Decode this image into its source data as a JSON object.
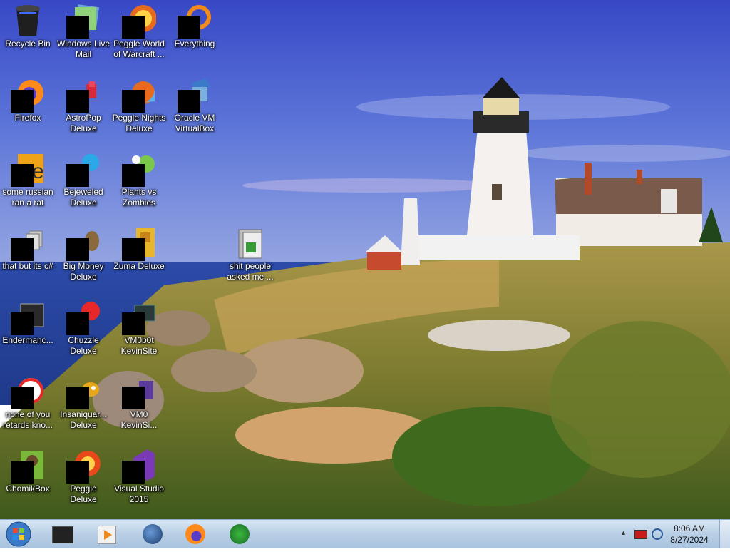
{
  "desktop": {
    "icons": [
      {
        "label": "Recycle Bin",
        "icon": "recycle-bin-icon"
      },
      {
        "label": "Windows Live Mail",
        "icon": "windows-live-mail-icon"
      },
      {
        "label": "Peggle World of Warcraft ...",
        "icon": "peggle-wow-icon"
      },
      {
        "label": "Everything",
        "icon": "everything-icon"
      },
      {
        "label": "Firefox",
        "icon": "firefox-icon"
      },
      {
        "label": "AstroPop Deluxe",
        "icon": "astropop-icon"
      },
      {
        "label": "Peggle Nights Deluxe",
        "icon": "peggle-nights-icon"
      },
      {
        "label": "Oracle VM VirtualBox",
        "icon": "virtualbox-icon"
      },
      {
        "label": "some russian ran a rat",
        "icon": "app-icon"
      },
      {
        "label": "Bejeweled Deluxe",
        "icon": "bejeweled-icon"
      },
      {
        "label": "Plants vs Zombies",
        "icon": "plants-vs-zombies-icon"
      },
      {
        "label": "that but its c#",
        "icon": "shortcut-icon"
      },
      {
        "label": "Big Money Deluxe",
        "icon": "big-money-icon"
      },
      {
        "label": "Zuma Deluxe",
        "icon": "zuma-icon"
      },
      {
        "label": "shit people asked me ...",
        "icon": "folder-icon"
      },
      {
        "label": "Endermanc...",
        "icon": "app-icon"
      },
      {
        "label": "Chuzzle Deluxe",
        "icon": "chuzzle-icon"
      },
      {
        "label": "VM0b0t KevinSite",
        "icon": "app-icon"
      },
      {
        "label": "none of you retards kno...",
        "icon": "app-icon"
      },
      {
        "label": "Insaniquar... Deluxe",
        "icon": "insaniquarium-icon"
      },
      {
        "label": "VM0 KevinSi...",
        "icon": "app-icon"
      },
      {
        "label": "ChomikBox",
        "icon": "chomikbox-icon"
      },
      {
        "label": "Peggle Deluxe",
        "icon": "peggle-icon"
      },
      {
        "label": "Visual Studio 2015",
        "icon": "visual-studio-icon"
      }
    ]
  },
  "taskbar": {
    "pinned": [
      {
        "icon": "explorer-icon"
      },
      {
        "icon": "media-player-icon"
      },
      {
        "icon": "globe-icon"
      },
      {
        "icon": "firefox-icon"
      },
      {
        "icon": "download-manager-icon"
      }
    ],
    "tray": {
      "icons": [
        "show-hidden-icons-chevron",
        "network-icon",
        "volume-icon"
      ]
    },
    "clock": {
      "time": "8:06 AM",
      "date": "8/27/2024"
    }
  },
  "colors": {
    "taskbar": "#b9cfe6",
    "sky": "#4a5fc8",
    "sea": "#2f4fa6"
  }
}
